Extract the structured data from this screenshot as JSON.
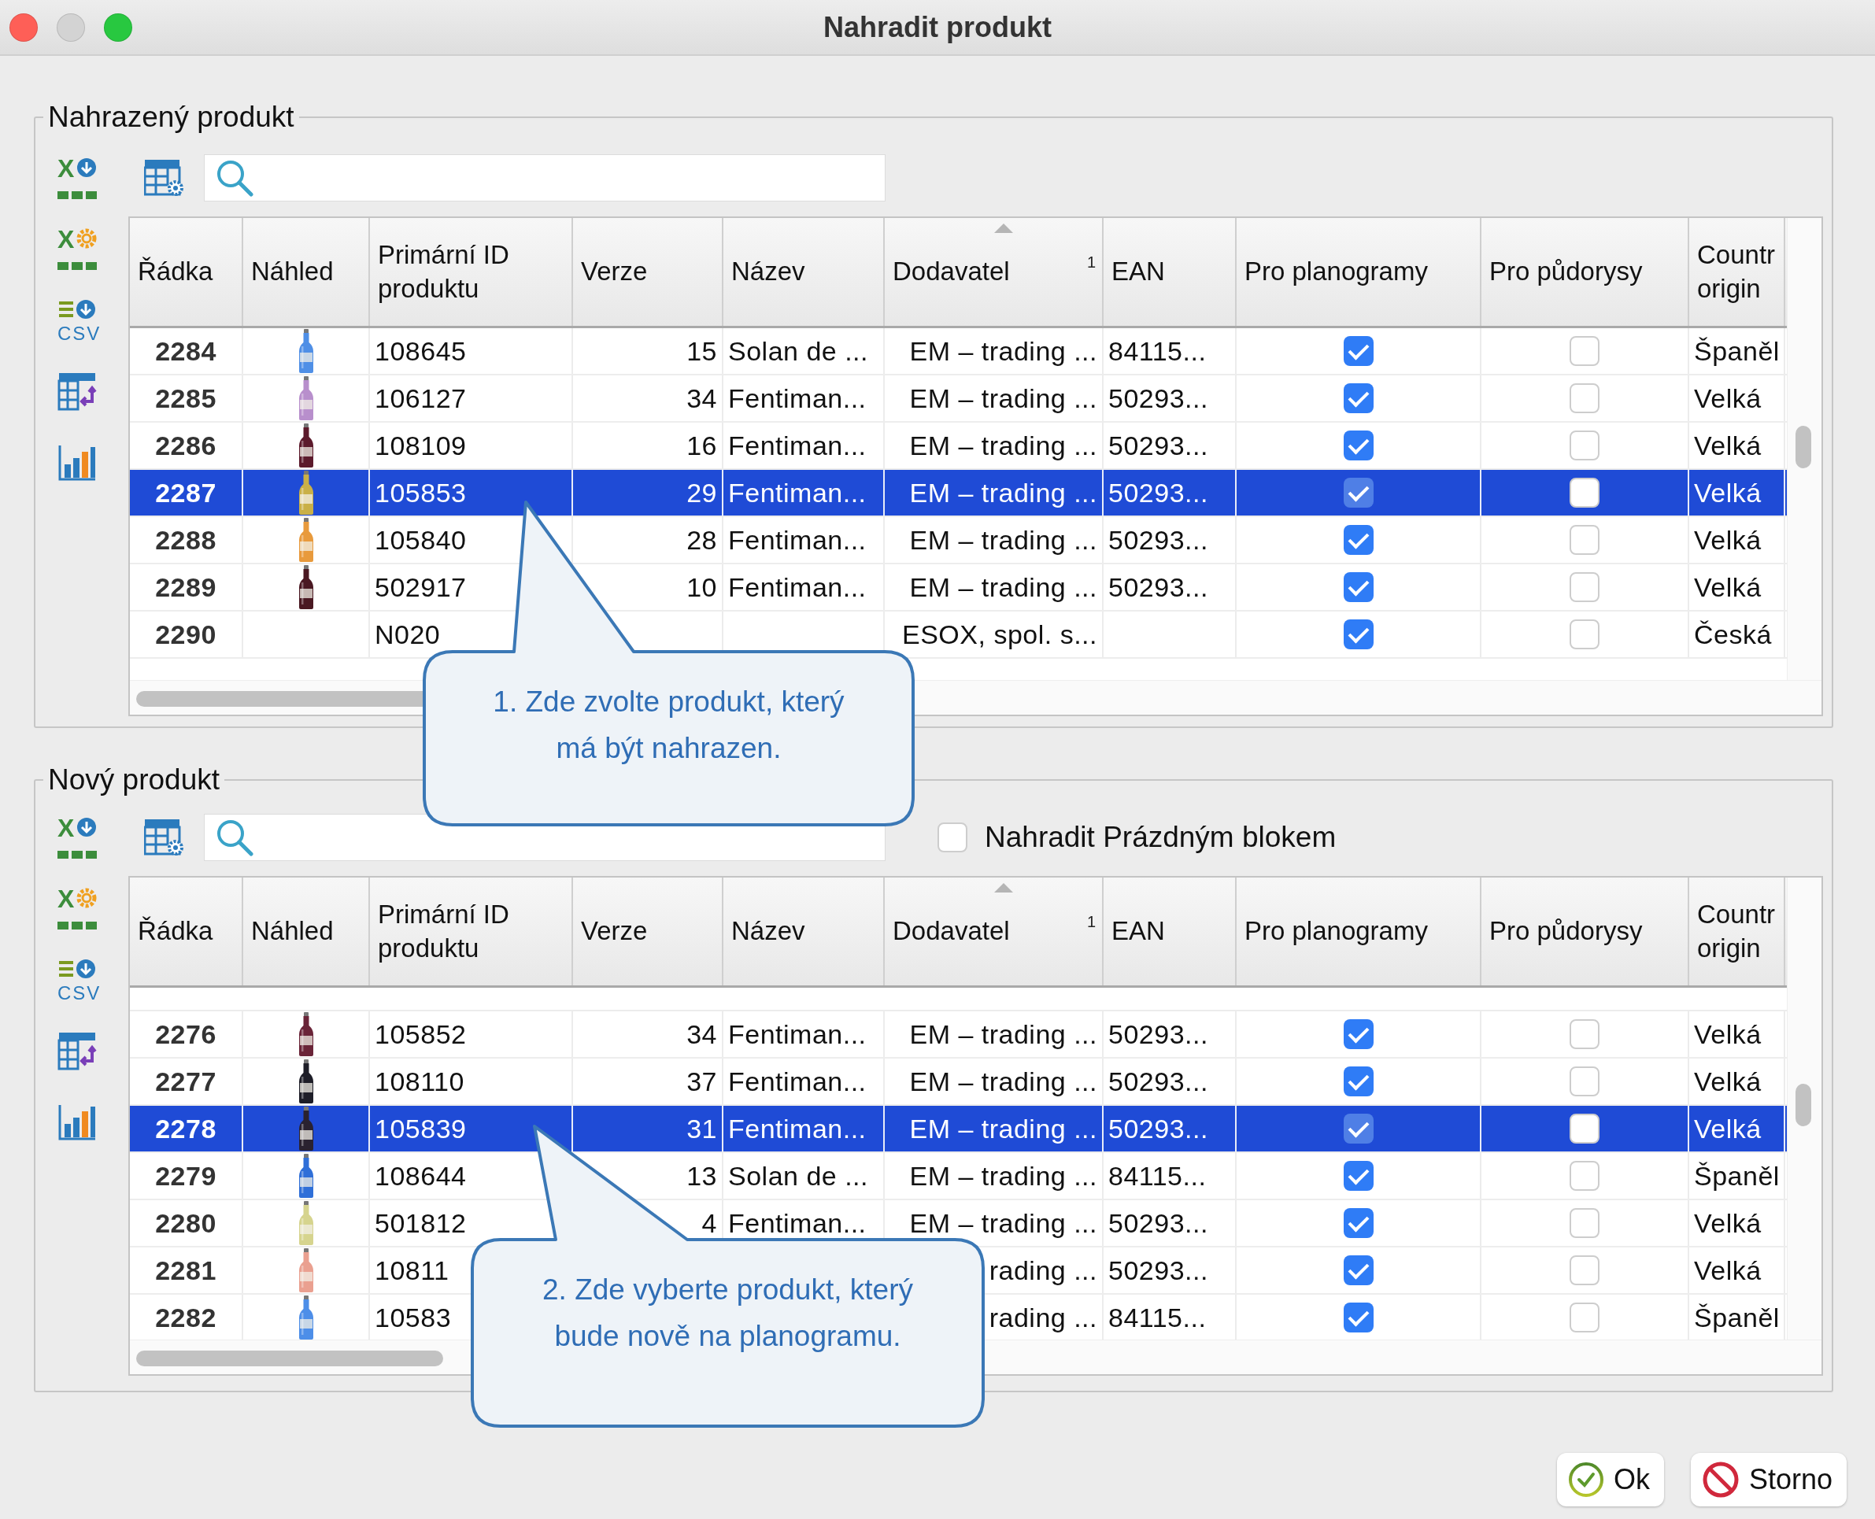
{
  "window": {
    "title": "Nahradit produkt",
    "controls": [
      {
        "kind": "close",
        "disabled": false
      },
      {
        "kind": "minimize",
        "disabled": true
      },
      {
        "kind": "zoom",
        "disabled": false
      }
    ]
  },
  "groups": [
    {
      "title": "Nahrazený produkt",
      "side_tools": [
        {
          "kind": "sheet-export",
          "label": "X"
        },
        {
          "kind": "sheet-settings",
          "label": "X"
        },
        {
          "kind": "csv-export",
          "label": "CSV"
        },
        {
          "kind": "table-swap"
        },
        {
          "kind": "chart"
        }
      ],
      "table": {
        "columns": [
          {
            "label": "Řádka",
            "sorted": false
          },
          {
            "label": "Náhled",
            "sorted": false
          },
          {
            "label": "Primární ID\nproduktu",
            "sorted": false
          },
          {
            "label": "Verze",
            "sorted": false
          },
          {
            "label": "Název",
            "sorted": false
          },
          {
            "label": "Dodavatel",
            "sorted": true,
            "sort_index": "1"
          },
          {
            "label": "EAN",
            "sorted": false
          },
          {
            "label": "Pro planogramy",
            "sorted": false
          },
          {
            "label": "Pro půdorysy",
            "sorted": false
          },
          {
            "label": "Countr\norigin",
            "sorted": false
          }
        ],
        "rows": [
          {
            "row": "2284",
            "id": "108645",
            "version": "15",
            "name": "Solan de ...",
            "supplier": "EM – trading ...",
            "ean": "84115...",
            "for_planograms": true,
            "for_floorplans": false,
            "country": "Španěl",
            "selected": false
          },
          {
            "row": "2285",
            "id": "106127",
            "version": "34",
            "name": "Fentiman...",
            "supplier": "EM – trading ...",
            "ean": "50293...",
            "for_planograms": true,
            "for_floorplans": false,
            "country": "Velká",
            "selected": false
          },
          {
            "row": "2286",
            "id": "108109",
            "version": "16",
            "name": "Fentiman...",
            "supplier": "EM – trading ...",
            "ean": "50293...",
            "for_planograms": true,
            "for_floorplans": false,
            "country": "Velká",
            "selected": false
          },
          {
            "row": "2287",
            "id": "105853",
            "version": "29",
            "name": "Fentiman...",
            "supplier": "EM – trading ...",
            "ean": "50293...",
            "for_planograms": true,
            "for_floorplans": false,
            "country": "Velká",
            "selected": true
          },
          {
            "row": "2288",
            "id": "105840",
            "version": "28",
            "name": "Fentiman...",
            "supplier": "EM – trading ...",
            "ean": "50293...",
            "for_planograms": true,
            "for_floorplans": false,
            "country": "Velká",
            "selected": false
          },
          {
            "row": "2289",
            "id": "502917",
            "version": "10",
            "name": "Fentiman...",
            "supplier": "EM – trading ...",
            "ean": "50293...",
            "for_planograms": true,
            "for_floorplans": false,
            "country": "Velká",
            "selected": false
          },
          {
            "row": "2290",
            "id": "N020",
            "supplier": "ESOX, spol. s...",
            "for_planograms": true,
            "for_floorplans": false,
            "country": "Česká",
            "selected": false
          }
        ]
      },
      "callout": "1. Zde zvolte produkt, který\nmá být nahrazen."
    },
    {
      "title": "Nový produkt",
      "side_tools": [
        {
          "kind": "sheet-export",
          "label": "X"
        },
        {
          "kind": "sheet-settings",
          "label": "X"
        },
        {
          "kind": "csv-export",
          "label": "CSV"
        },
        {
          "kind": "table-swap"
        },
        {
          "kind": "chart"
        }
      ],
      "option": {
        "label": "Nahradit Prázdným blokem",
        "checked": false
      },
      "table": {
        "columns": [
          {
            "label": "Řádka",
            "sorted": false
          },
          {
            "label": "Náhled",
            "sorted": false
          },
          {
            "label": "Primární ID\nproduktu",
            "sorted": false
          },
          {
            "label": "Verze",
            "sorted": false
          },
          {
            "label": "Název",
            "sorted": false
          },
          {
            "label": "Dodavatel",
            "sorted": true,
            "sort_index": "1"
          },
          {
            "label": "EAN",
            "sorted": false
          },
          {
            "label": "Pro planogramy",
            "sorted": false
          },
          {
            "label": "Pro půdorysy",
            "sorted": false
          },
          {
            "label": "Countr\norigin",
            "sorted": false
          }
        ],
        "rows": [
          {
            "row": "2276",
            "id": "105852",
            "version": "34",
            "name": "Fentiman...",
            "supplier": "EM – trading ...",
            "ean": "50293...",
            "for_planograms": true,
            "for_floorplans": false,
            "country": "Velká",
            "selected": false
          },
          {
            "row": "2277",
            "id": "108110",
            "version": "37",
            "name": "Fentiman...",
            "supplier": "EM – trading ...",
            "ean": "50293...",
            "for_planograms": true,
            "for_floorplans": false,
            "country": "Velká",
            "selected": false
          },
          {
            "row": "2278",
            "id": "105839",
            "version": "31",
            "name": "Fentiman...",
            "supplier": "EM – trading ...",
            "ean": "50293...",
            "for_planograms": true,
            "for_floorplans": false,
            "country": "Velká",
            "selected": true
          },
          {
            "row": "2279",
            "id": "108644",
            "version": "13",
            "name": "Solan de ...",
            "supplier": "EM – trading ...",
            "ean": "84115...",
            "for_planograms": true,
            "for_floorplans": false,
            "country": "Španěl",
            "selected": false
          },
          {
            "row": "2280",
            "id": "501812",
            "version": "4",
            "name": "Fentiman...",
            "supplier": "EM – trading ...",
            "ean": "50293...",
            "for_planograms": true,
            "for_floorplans": false,
            "country": "Velká",
            "selected": false
          },
          {
            "row": "2281",
            "id": "10811",
            "supplier": "rading ...",
            "ean": "50293...",
            "for_planograms": true,
            "for_floorplans": false,
            "country": "Velká",
            "selected": false
          },
          {
            "row": "2282",
            "id": "10583",
            "supplier": "rading ...",
            "ean": "84115...",
            "for_planograms": true,
            "for_floorplans": false,
            "country": "Španěl",
            "selected": false
          }
        ]
      },
      "callout": "2. Zde vyberte produkt, který\nbude nově na planogramu."
    }
  ],
  "buttons": [
    {
      "kind": "ok",
      "label": "Ok"
    },
    {
      "kind": "cancel",
      "label": "Storno"
    }
  ]
}
